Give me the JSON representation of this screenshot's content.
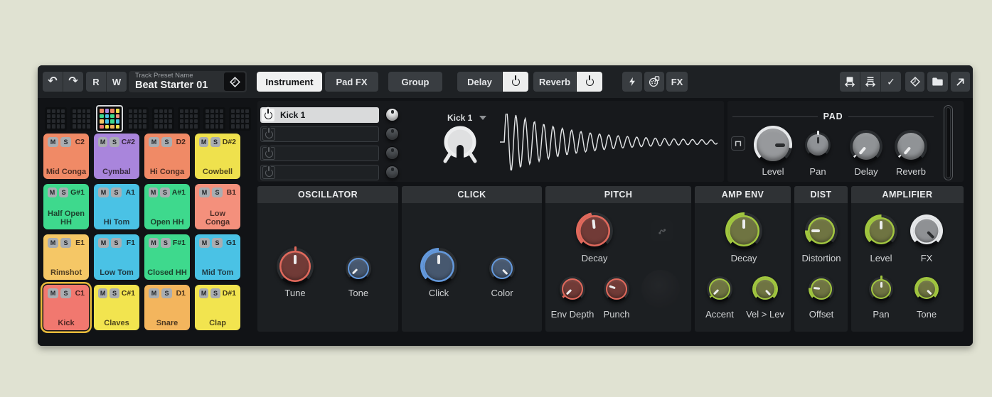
{
  "palette": {
    "accent-red": "#E0695C",
    "body-red": "#713B37",
    "accent-blue": "#6398DB",
    "body-blue": "#47586F",
    "accent-green": "#A1C63F",
    "body-green": "#6F7442",
    "accent-gray": "#E6E8EA",
    "body-gray": "#97999C",
    "pad-selected-ring": "#E8BB3B"
  },
  "icons": {
    "undo": "↶",
    "redo": "↷",
    "check": "✓"
  },
  "labels": {
    "mute": "M",
    "solo": "S"
  },
  "toolbar": {
    "read": "R",
    "write": "W",
    "preset_label": "Track Preset Name",
    "preset_name": "Beat Starter 01",
    "tab_instrument": "Instrument",
    "tab_pad_fx": "Pad FX",
    "tab_group": "Group",
    "tab_delay": "Delay",
    "tab_reverb": "Reverb",
    "fx": "FX"
  },
  "sample": {
    "name": "Kick 1"
  },
  "slots": [
    {
      "label": "Kick 1"
    },
    {
      "label": ""
    },
    {
      "label": ""
    },
    {
      "label": ""
    }
  ],
  "pad_section": {
    "title": "PAD",
    "level": "Level",
    "pan": "Pan",
    "delay": "Delay",
    "reverb": "Reverb"
  },
  "oscillator": {
    "title": "OSCILLATOR",
    "tune": "Tune",
    "tone": "Tone"
  },
  "click": {
    "title": "CLICK",
    "click": "Click",
    "color": "Color"
  },
  "pitch": {
    "title": "PITCH",
    "decay": "Decay",
    "env_depth": "Env Depth",
    "punch": "Punch"
  },
  "amp_env": {
    "title": "AMP ENV",
    "decay": "Decay",
    "accent": "Accent",
    "vel_lev": "Vel > Lev"
  },
  "dist": {
    "title": "DIST",
    "distortion": "Distortion",
    "offset": "Offset"
  },
  "amplifier": {
    "title": "AMPLIFIER",
    "level": "Level",
    "fx": "FX",
    "pan": "Pan",
    "tone": "Tone"
  },
  "pads": [
    {
      "note": "C2",
      "name": "Mid Conga",
      "color": "#F08A66"
    },
    {
      "note": "C#2",
      "name": "Cymbal",
      "color": "#A985DC"
    },
    {
      "note": "D2",
      "name": "Hi Conga",
      "color": "#F08A66"
    },
    {
      "note": "D#2",
      "name": "Cowbell",
      "color": "#EFE14D"
    },
    {
      "note": "G#1",
      "name": "Half Open HH",
      "color": "#3ED98D"
    },
    {
      "note": "A1",
      "name": "Hi Tom",
      "color": "#4AC2E5"
    },
    {
      "note": "A#1",
      "name": "Open HH",
      "color": "#3ED98D"
    },
    {
      "note": "B1",
      "name": "Low Conga",
      "color": "#F4907C"
    },
    {
      "note": "E1",
      "name": "Rimshot",
      "color": "#F5C766"
    },
    {
      "note": "F1",
      "name": "Low Tom",
      "color": "#4AC2E5"
    },
    {
      "note": "F#1",
      "name": "Closed HH",
      "color": "#3ED98D"
    },
    {
      "note": "G1",
      "name": "Mid Tom",
      "color": "#4AC2E5"
    },
    {
      "note": "C1",
      "name": "Kick",
      "color": "#F1786F"
    },
    {
      "note": "C#1",
      "name": "Claves",
      "color": "#F2E44F"
    },
    {
      "note": "D1",
      "name": "Snare",
      "color": "#F3B55D"
    },
    {
      "note": "D#1",
      "name": "Clap",
      "color": "#F2E44F"
    }
  ]
}
